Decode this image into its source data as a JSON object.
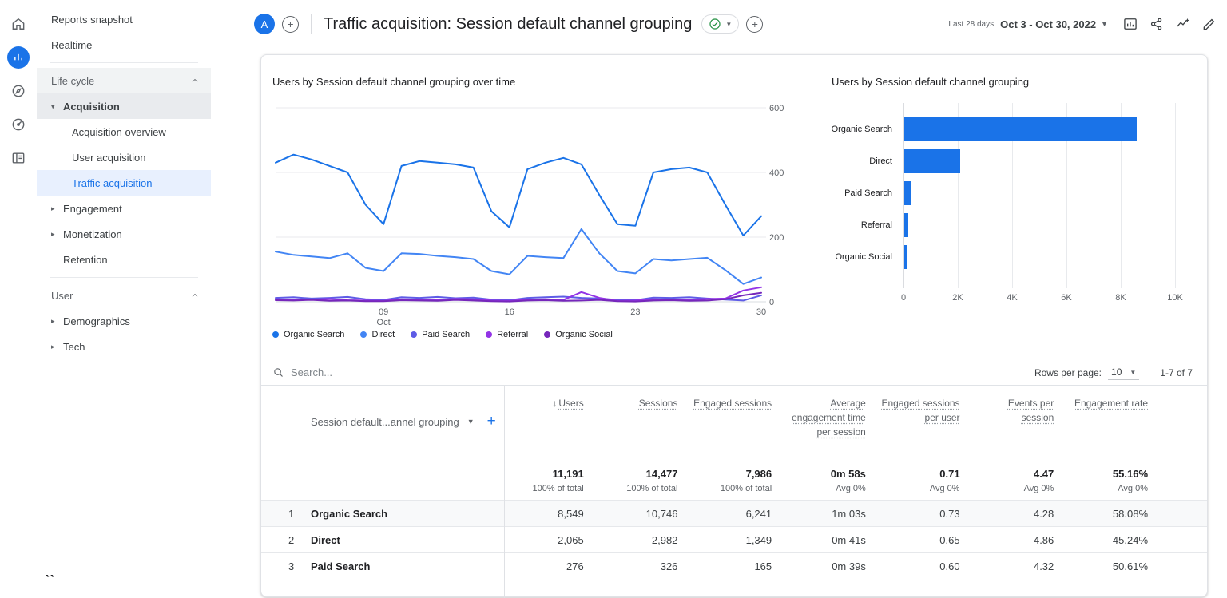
{
  "colors": {
    "accent": "#1a73e8",
    "selected_bg": "#e8f0fe",
    "green": "#1e8e3e"
  },
  "rail": {
    "icons": [
      "home-icon",
      "reports-icon",
      "explore-icon",
      "advertising-icon",
      "library-icon"
    ]
  },
  "sidebar": {
    "reports_snapshot": "Reports snapshot",
    "realtime": "Realtime",
    "life_cycle": "Life cycle",
    "acquisition": "Acquisition",
    "acquisition_overview": "Acquisition overview",
    "user_acquisition": "User acquisition",
    "traffic_acquisition": "Traffic acquisition",
    "engagement": "Engagement",
    "monetization": "Monetization",
    "retention": "Retention",
    "user": "User",
    "demographics": "Demographics",
    "tech": "Tech"
  },
  "header": {
    "avatar_letter": "A",
    "title": "Traffic acquisition: Session default channel grouping",
    "date_label": "Last 28 days",
    "date_range": "Oct 3 - Oct 30, 2022",
    "toolbar_icons": [
      "customize-report-icon",
      "share-icon",
      "insights-icon",
      "edit-icon"
    ]
  },
  "chart_data": [
    {
      "type": "line",
      "title": "Users by Session default channel grouping over time",
      "ylabel": "",
      "ylim": [
        0,
        600
      ],
      "yticks": [
        0,
        200,
        400,
        600
      ],
      "grid": true,
      "legend_position": "bottom",
      "x_ticks": [
        {
          "label": "09",
          "sub": "Oct",
          "index": 6
        },
        {
          "label": "16",
          "sub": "",
          "index": 13
        },
        {
          "label": "23",
          "sub": "",
          "index": 20
        },
        {
          "label": "30",
          "sub": "",
          "index": 27
        }
      ],
      "series": [
        {
          "name": "Organic Search",
          "color": "#1a73e8",
          "values": [
            430,
            455,
            440,
            420,
            400,
            300,
            240,
            420,
            435,
            430,
            425,
            415,
            280,
            230,
            410,
            430,
            445,
            425,
            330,
            240,
            235,
            400,
            410,
            415,
            400,
            300,
            205,
            265
          ]
        },
        {
          "name": "Direct",
          "color": "#4285f4",
          "values": [
            155,
            145,
            140,
            135,
            150,
            105,
            95,
            150,
            148,
            142,
            138,
            132,
            95,
            85,
            142,
            138,
            135,
            225,
            150,
            95,
            88,
            132,
            128,
            132,
            136,
            98,
            55,
            75
          ]
        },
        {
          "name": "Paid Search",
          "color": "#5e5ce6",
          "values": [
            12,
            14,
            10,
            12,
            15,
            8,
            6,
            14,
            12,
            15,
            11,
            13,
            7,
            5,
            12,
            14,
            16,
            12,
            10,
            6,
            5,
            13,
            12,
            14,
            10,
            7,
            4,
            20
          ]
        },
        {
          "name": "Referral",
          "color": "#9334e6",
          "values": [
            8,
            6,
            7,
            9,
            5,
            4,
            3,
            8,
            7,
            6,
            9,
            8,
            4,
            3,
            7,
            8,
            6,
            30,
            12,
            3,
            4,
            8,
            6,
            7,
            9,
            10,
            35,
            45
          ]
        },
        {
          "name": "Organic Social",
          "color": "#7627bb",
          "values": [
            5,
            4,
            6,
            3,
            4,
            2,
            2,
            5,
            4,
            3,
            6,
            4,
            2,
            1,
            4,
            5,
            3,
            4,
            6,
            2,
            1,
            4,
            5,
            3,
            4,
            8,
            20,
            28
          ]
        }
      ]
    },
    {
      "type": "bar",
      "title": "Users by Session default channel grouping",
      "orientation": "horizontal",
      "categories": [
        "Organic Search",
        "Direct",
        "Paid Search",
        "Referral",
        "Organic Social"
      ],
      "values": [
        8549,
        2065,
        276,
        150,
        100
      ],
      "xlim": [
        0,
        10000
      ],
      "xtick_labels": [
        "0",
        "2K",
        "4K",
        "6K",
        "8K",
        "10K"
      ],
      "bar_color": "#1a73e8"
    }
  ],
  "table": {
    "search_placeholder": "Search...",
    "rows_per_page_label": "Rows per page:",
    "rows_per_page": "10",
    "pagination": "1-7 of 7",
    "dimension_header": "Session default...annel grouping",
    "columns": [
      "Users",
      "Sessions",
      "Engaged sessions",
      "Average engagement time per session",
      "Engaged sessions per user",
      "Events per session",
      "Engagement rate"
    ],
    "totals": {
      "users": "11,191",
      "users_sub": "100% of total",
      "sessions": "14,477",
      "sessions_sub": "100% of total",
      "engaged_sessions": "7,986",
      "engaged_sessions_sub": "100% of total",
      "avg_engagement_time": "0m 58s",
      "avg_engagement_time_sub": "Avg 0%",
      "engaged_per_user": "0.71",
      "engaged_per_user_sub": "Avg 0%",
      "events_per_session": "4.47",
      "events_per_session_sub": "Avg 0%",
      "engagement_rate": "55.16%",
      "engagement_rate_sub": "Avg 0%"
    },
    "rows": [
      {
        "index": "1",
        "channel": "Organic Search",
        "values": [
          "8,549",
          "10,746",
          "6,241",
          "1m 03s",
          "0.73",
          "4.28",
          "58.08%"
        ]
      },
      {
        "index": "2",
        "channel": "Direct",
        "values": [
          "2,065",
          "2,982",
          "1,349",
          "0m 41s",
          "0.65",
          "4.86",
          "45.24%"
        ]
      },
      {
        "index": "3",
        "channel": "Paid Search",
        "values": [
          "276",
          "326",
          "165",
          "0m 39s",
          "0.60",
          "4.32",
          "50.61%"
        ]
      }
    ]
  }
}
